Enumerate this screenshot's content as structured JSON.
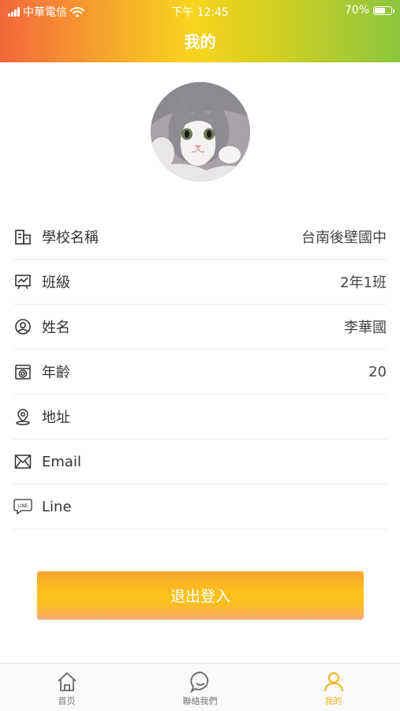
{
  "status_bar": {
    "carrier": "中華電信",
    "time": "下午 12:45",
    "battery_percent_text": "70%",
    "battery_level": 0.7
  },
  "header": {
    "title": "我的"
  },
  "profile_rows": [
    {
      "icon": "building-icon",
      "label": "學校名稱",
      "value": "台南後壁國中"
    },
    {
      "icon": "classroom-board-icon",
      "label": "班級",
      "value": "2年1班"
    },
    {
      "icon": "user-circle-icon",
      "label": "姓名",
      "value": "李華國"
    },
    {
      "icon": "age-icon",
      "label": "年齡",
      "value": "20"
    },
    {
      "icon": "location-pin-icon",
      "label": "地址",
      "value": ""
    },
    {
      "icon": "mail-icon",
      "label": "Email",
      "value": ""
    },
    {
      "icon": "line-app-icon",
      "label": "Line",
      "value": ""
    }
  ],
  "logout_label": "退出登入",
  "tabbar": {
    "tabs": [
      {
        "icon": "home-icon",
        "label": "首页",
        "active": false
      },
      {
        "icon": "chat-bubble-icon",
        "label": "聯絡我們",
        "active": false
      },
      {
        "icon": "user-icon",
        "label": "我的",
        "active": true
      }
    ]
  },
  "colors": {
    "header_gradient": [
      "#f3663c",
      "#f8d41e",
      "#8cc63e"
    ],
    "accent": "#f2b21b",
    "button": "#fcc21b"
  }
}
